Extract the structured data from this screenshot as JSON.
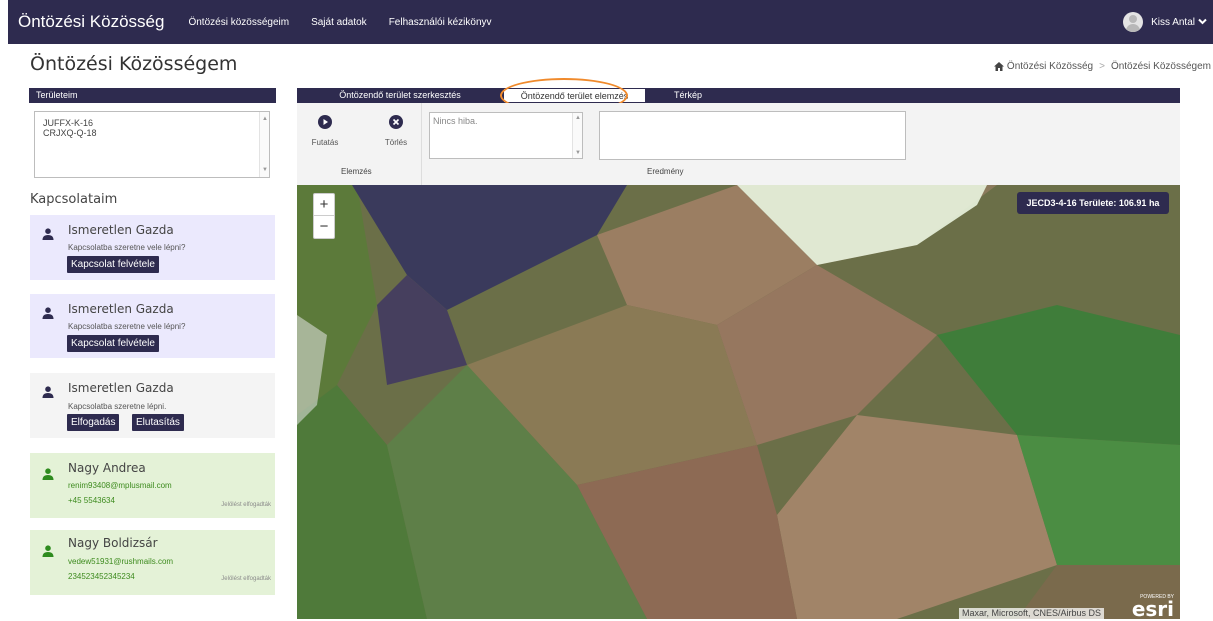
{
  "navbar": {
    "brand": "Öntözési Közösség",
    "links": [
      "Öntözési közösségeim",
      "Saját adatok",
      "Felhasználói kézikönyv"
    ],
    "user_name": "Kiss Antal",
    "user_chevron": "❯"
  },
  "page": {
    "title": "Öntözési Közösségem",
    "breadcrumb": [
      "Öntözési Közösség",
      "Öntözési Közösségem"
    ],
    "breadcrumb_sep": ">"
  },
  "areas": {
    "header": "Területeim",
    "items": [
      "JUFFX-K-16",
      "CRJXQ-Q-18"
    ]
  },
  "contacts": {
    "title": "Kapcsolataim",
    "items": [
      {
        "name": "Ismeretlen Gazda",
        "line1": "Kapcsolatba szeretne vele lépni?",
        "button": "Kapcsolat felvétele"
      },
      {
        "name": "Ismeretlen Gazda",
        "line1": "Kapcsolatba szeretne vele lépni?",
        "button": "Kapcsolat felvétele"
      },
      {
        "name": "Ismeretlen Gazda",
        "line1": "Kapcsolatba szeretne lépni.",
        "accept": "Elfogadás",
        "reject": "Elutasítás"
      },
      {
        "name": "Nagy Andrea",
        "email": "renim93408@mplusmail.com",
        "phone": "+45 5543634",
        "status": "Jelölést elfogadták"
      },
      {
        "name": "Nagy Boldizsár",
        "email": "vedew51931@rushmails.com",
        "phone": "234523452345234",
        "status": "Jelölést elfogadták"
      }
    ]
  },
  "tabs": [
    {
      "label": "Öntözendő terület szerkesztés",
      "active": false
    },
    {
      "label": "Öntözendő terület elemzés",
      "active": true
    },
    {
      "label": "Térkép",
      "active": false
    }
  ],
  "toolbar": {
    "run_label": "Futatás",
    "delete_label": "Törlés",
    "group_label": "Elemzés",
    "errors_text": "Nincs hiba.",
    "result_label": "Eredmény"
  },
  "map": {
    "zoom_in": "+",
    "zoom_out": "−",
    "area_label": "JECD3-4-16 Területe: 106.91 ha",
    "attribution": "Maxar, Microsoft, CNES/Airbus DS",
    "esri_powered": "POWERED BY",
    "esri_logo": "esri"
  },
  "colors": {
    "primary": "#2e2b4f",
    "highlight": "#f08a2c",
    "accepted_bg": "#e4f2d7",
    "request_bg": "#ebe9fd"
  }
}
